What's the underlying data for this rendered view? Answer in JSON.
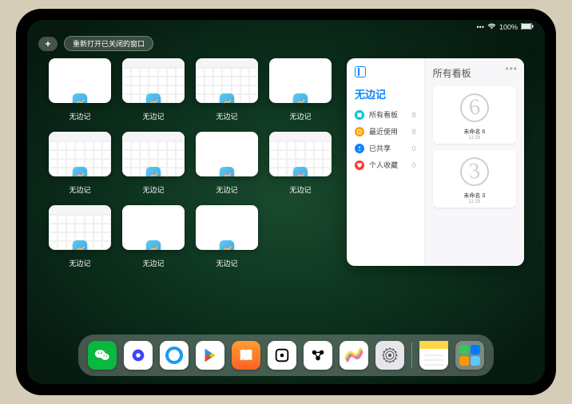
{
  "status": {
    "time": "",
    "battery": "100%"
  },
  "top": {
    "plus": "+",
    "reopen_label": "重新打开已关闭的窗口"
  },
  "app_name": "无边记",
  "panel": {
    "left_title": "无边记",
    "right_title": "所有看板",
    "items": [
      {
        "label": "所有看板",
        "count": "8",
        "color": "#0bc1d6"
      },
      {
        "label": "最近使用",
        "count": "8",
        "color": "#ff9f0a"
      },
      {
        "label": "已共享",
        "count": "0",
        "color": "#0a84ff"
      },
      {
        "label": "个人收藏",
        "count": "0",
        "color": "#ff3b30"
      }
    ],
    "boards": [
      {
        "name": "未命名 6",
        "sub": "11:28",
        "digit": "6"
      },
      {
        "name": "未命名 3",
        "sub": "11:28",
        "digit": "3"
      }
    ]
  },
  "dock_apps": [
    "wechat",
    "quark",
    "browser",
    "play",
    "books",
    "dice",
    "camera",
    "freeform",
    "settings",
    "notes",
    "library"
  ]
}
